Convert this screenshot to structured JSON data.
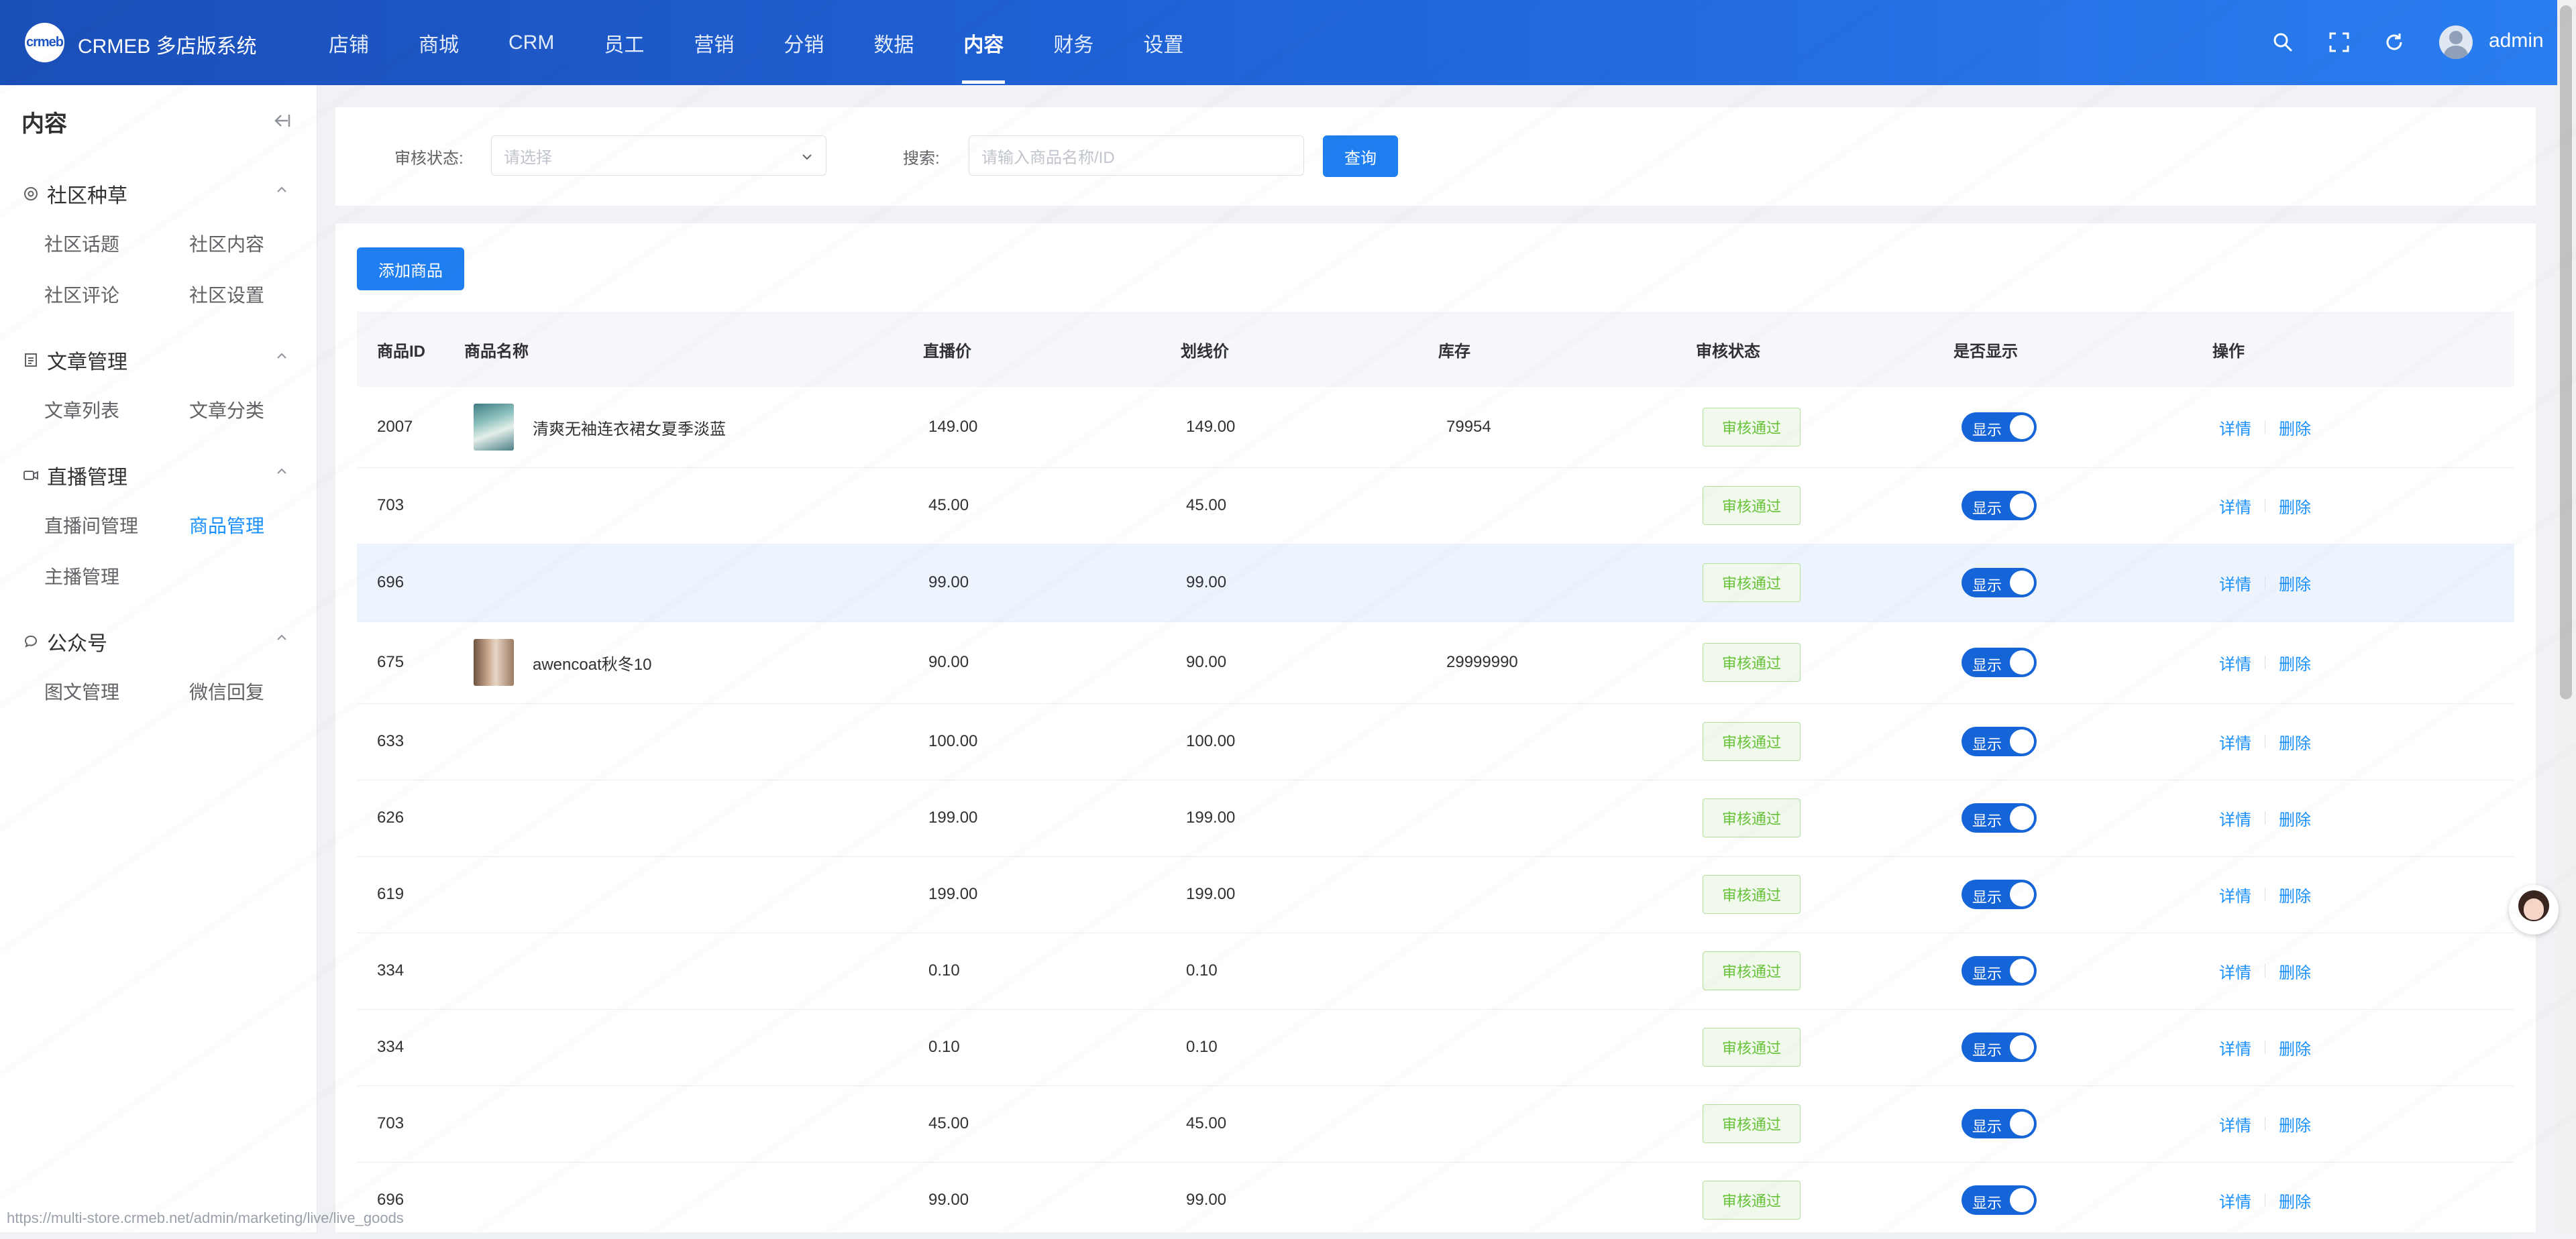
{
  "header": {
    "logo_text": "crmeb",
    "brand": "CRMEB 多店版系统",
    "nav": [
      {
        "label": "店铺",
        "name": "nav-store"
      },
      {
        "label": "商城",
        "name": "nav-mall"
      },
      {
        "label": "CRM",
        "name": "nav-crm"
      },
      {
        "label": "员工",
        "name": "nav-staff"
      },
      {
        "label": "营销",
        "name": "nav-marketing"
      },
      {
        "label": "分销",
        "name": "nav-distribution"
      },
      {
        "label": "数据",
        "name": "nav-data"
      },
      {
        "label": "内容",
        "name": "nav-content"
      },
      {
        "label": "财务",
        "name": "nav-finance"
      },
      {
        "label": "设置",
        "name": "nav-settings"
      }
    ],
    "active_nav": 7,
    "user": "admin"
  },
  "sidebar": {
    "title": "内容",
    "groups": [
      {
        "title": "社区种草",
        "icon": "community-icon",
        "items": [
          "社区话题",
          "社区内容",
          "社区评论",
          "社区设置"
        ]
      },
      {
        "title": "文章管理",
        "icon": "article-icon",
        "items": [
          "文章列表",
          "文章分类"
        ]
      },
      {
        "title": "直播管理",
        "icon": "live-camera-icon",
        "items": [
          "直播间管理",
          "商品管理",
          "主播管理"
        ]
      },
      {
        "title": "公众号",
        "icon": "wechat-icon",
        "items": [
          "图文管理",
          "微信回复"
        ]
      }
    ],
    "active_item": "商品管理"
  },
  "filter": {
    "status_label": "审核状态:",
    "status_placeholder": "请选择",
    "search_label": "搜索:",
    "search_placeholder": "请输入商品名称/ID",
    "query_button": "查询"
  },
  "list": {
    "add_button": "添加商品",
    "columns": [
      "商品ID",
      "商品名称",
      "直播价",
      "划线价",
      "库存",
      "审核状态",
      "是否显示",
      "操作"
    ],
    "rows": [
      {
        "id": "2007",
        "name": "清爽无袖连衣裙女夏季淡蓝",
        "thumb": "t1",
        "live_price": "149.00",
        "list_price": "149.00",
        "stock": "79954",
        "status": "审核通过",
        "show": "显示"
      },
      {
        "id": "703",
        "name": "",
        "thumb": "",
        "live_price": "45.00",
        "list_price": "45.00",
        "stock": "",
        "status": "审核通过",
        "show": "显示"
      },
      {
        "id": "696",
        "name": "",
        "thumb": "",
        "live_price": "99.00",
        "list_price": "99.00",
        "stock": "",
        "status": "审核通过",
        "show": "显示"
      },
      {
        "id": "675",
        "name": "awencoat秋冬10",
        "thumb": "t2",
        "live_price": "90.00",
        "list_price": "90.00",
        "stock": "29999990",
        "status": "审核通过",
        "show": "显示"
      },
      {
        "id": "633",
        "name": "",
        "thumb": "",
        "live_price": "100.00",
        "list_price": "100.00",
        "stock": "",
        "status": "审核通过",
        "show": "显示"
      },
      {
        "id": "626",
        "name": "",
        "thumb": "",
        "live_price": "199.00",
        "list_price": "199.00",
        "stock": "",
        "status": "审核通过",
        "show": "显示"
      },
      {
        "id": "619",
        "name": "",
        "thumb": "",
        "live_price": "199.00",
        "list_price": "199.00",
        "stock": "",
        "status": "审核通过",
        "show": "显示"
      },
      {
        "id": "334",
        "name": "",
        "thumb": "",
        "live_price": "0.10",
        "list_price": "0.10",
        "stock": "",
        "status": "审核通过",
        "show": "显示"
      },
      {
        "id": "334",
        "name": "",
        "thumb": "",
        "live_price": "0.10",
        "list_price": "0.10",
        "stock": "",
        "status": "审核通过",
        "show": "显示"
      },
      {
        "id": "703",
        "name": "",
        "thumb": "",
        "live_price": "45.00",
        "list_price": "45.00",
        "stock": "",
        "status": "审核通过",
        "show": "显示"
      },
      {
        "id": "696",
        "name": "",
        "thumb": "",
        "live_price": "99.00",
        "list_price": "99.00",
        "stock": "",
        "status": "审核通过",
        "show": "显示"
      }
    ],
    "actions": {
      "detail": "详情",
      "delete": "删除"
    }
  },
  "status_bar_url": "https://multi-store.crmeb.net/admin/marketing/live/live_goods",
  "colors": {
    "header_start": "#1b4fb8",
    "header_end": "#2a7ef0",
    "primary": "#1f7ff0",
    "link": "#1890ff",
    "success": "#67c23a",
    "switch_on": "#1565d8"
  }
}
